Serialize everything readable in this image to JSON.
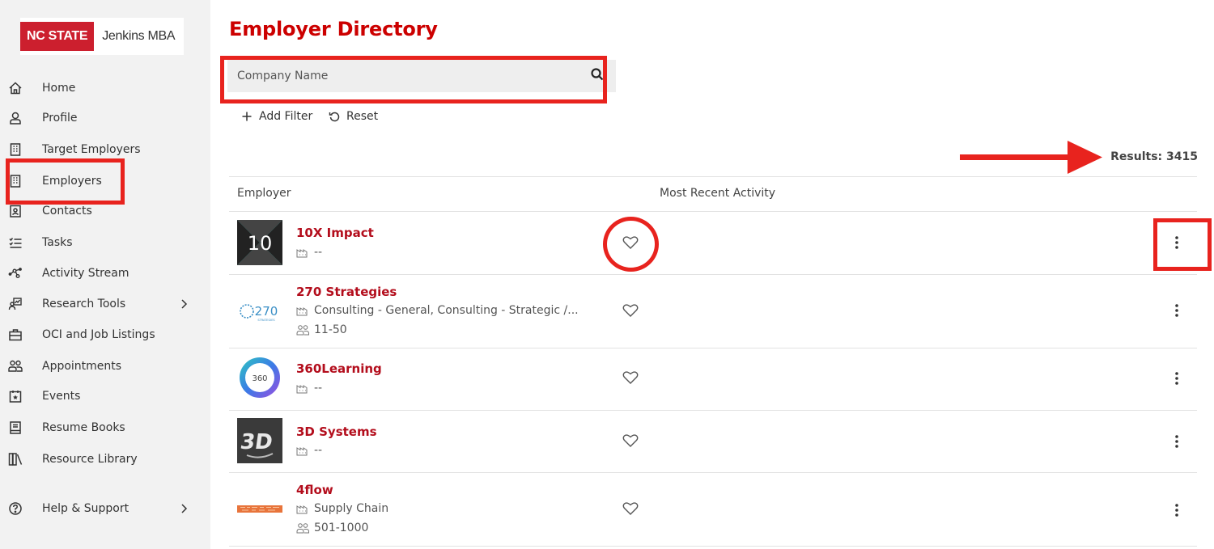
{
  "brand": {
    "school": "NC STATE",
    "program": "Jenkins MBA"
  },
  "sidebar": {
    "items": [
      {
        "label": "Home",
        "icon": "home-icon"
      },
      {
        "label": "Profile",
        "icon": "user-icon"
      },
      {
        "label": "Target Employers",
        "icon": "building-icon"
      },
      {
        "label": "Employers",
        "icon": "building-icon"
      },
      {
        "label": "Contacts",
        "icon": "contact-card-icon"
      },
      {
        "label": "Tasks",
        "icon": "checklist-icon"
      },
      {
        "label": "Activity Stream",
        "icon": "network-icon"
      },
      {
        "label": "Research Tools",
        "icon": "research-icon"
      },
      {
        "label": "OCI and Job Listings",
        "icon": "briefcase-icon"
      },
      {
        "label": "Appointments",
        "icon": "people-icon"
      },
      {
        "label": "Events",
        "icon": "calendar-star-icon"
      },
      {
        "label": "Resume Books",
        "icon": "book-icon"
      },
      {
        "label": "Resource Library",
        "icon": "library-icon"
      },
      {
        "label": "Help & Support",
        "icon": "help-circle-icon"
      }
    ]
  },
  "main": {
    "title": "Employer Directory",
    "search": {
      "placeholder": "Company Name"
    },
    "add_filter_label": "Add Filter",
    "reset_label": "Reset",
    "results_label": "Results: 3415",
    "columns": {
      "employer": "Employer",
      "activity": "Most Recent Activity"
    },
    "rows": [
      {
        "name": "10X Impact",
        "industry": "--",
        "size": ""
      },
      {
        "name": "270 Strategies",
        "industry": "Consulting - General, Consulting - Strategic /...",
        "size": "11-50"
      },
      {
        "name": "360Learning",
        "industry": "--",
        "size": ""
      },
      {
        "name": "3D Systems",
        "industry": "--",
        "size": ""
      },
      {
        "name": "4flow",
        "industry": "Supply Chain",
        "size": "501-1000"
      }
    ]
  },
  "colors": {
    "brand_red": "#cc1f2e",
    "title_red": "#cc0000",
    "link_red": "#b30d1c",
    "annotation_red": "#e8231e",
    "sidebar_bg": "#f2f2f2"
  }
}
